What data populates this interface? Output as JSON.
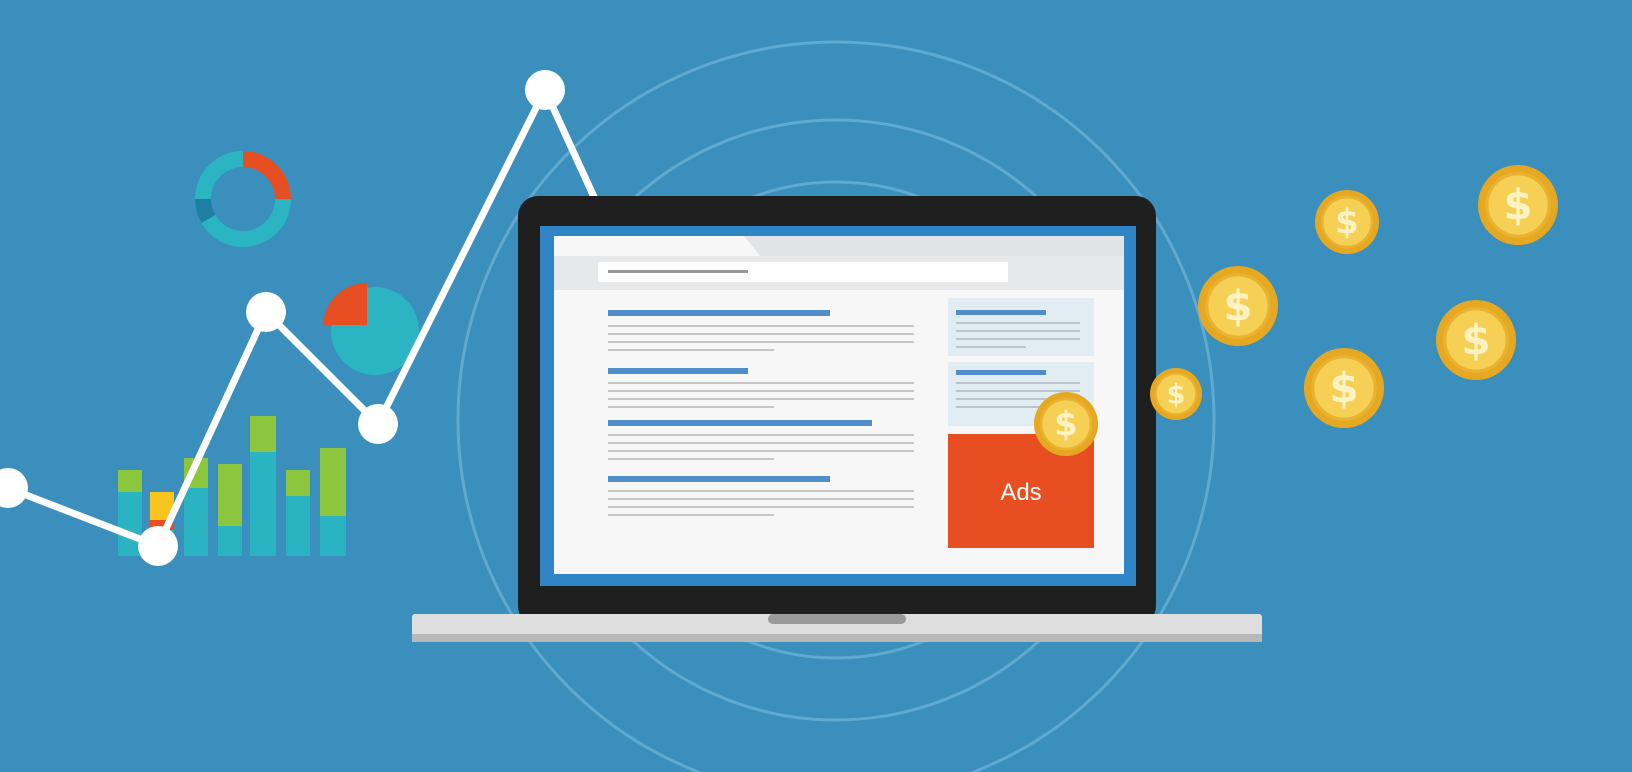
{
  "ad_block": {
    "label": "Ads"
  },
  "coin": {
    "symbol": "$"
  },
  "colors": {
    "background": "#3a8fbc",
    "laptop_bezel": "#1f1f1f",
    "screen_frame": "#2f85c6",
    "page": "#f7f7f7",
    "address_bar": "#e7e8e9",
    "text_line_blue": "#4f8ecb",
    "text_line_gray": "#c7c7c7",
    "sidebar_card": "#e1ecf3",
    "ad_block": "#e74e22",
    "coin_outer": "#e6a821",
    "coin_inner": "#f6cf55",
    "coin_symbol": "#fff3c4",
    "donut_teal": "#2bb5c2",
    "donut_red": "#e74e22",
    "donut_dark": "#1f7ea3",
    "bar_teal": "#2ab3c1",
    "bar_green": "#8cc63f",
    "bar_yellow": "#f7c51e",
    "trend_line": "#ffffff",
    "ring": "#6db2d7"
  }
}
